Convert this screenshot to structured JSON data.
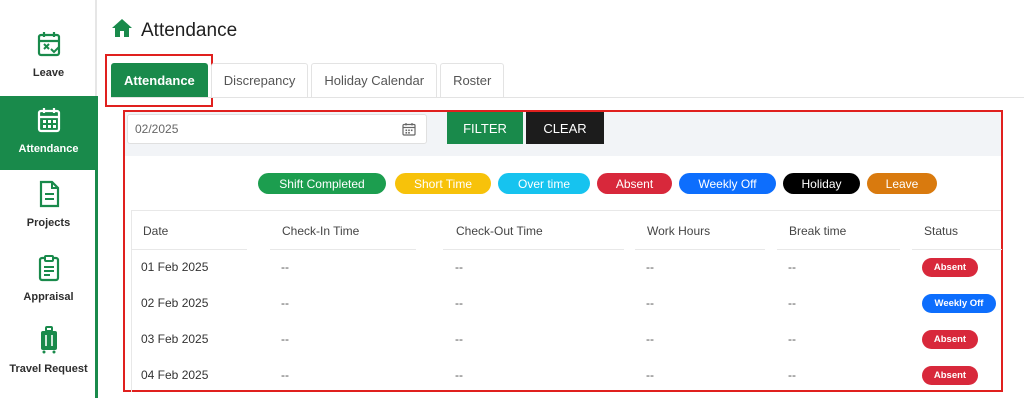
{
  "sidebar": {
    "items": [
      {
        "label": "Leave",
        "icon": "calendar-x-icon"
      },
      {
        "label": "Attendance",
        "icon": "calendar-grid-icon",
        "active": true
      },
      {
        "label": "Projects",
        "icon": "document-icon"
      },
      {
        "label": "Appraisal",
        "icon": "clipboard-icon"
      },
      {
        "label": "Travel Request",
        "icon": "luggage-icon"
      }
    ]
  },
  "header": {
    "title": "Attendance",
    "icon": "home-icon"
  },
  "tabs": [
    {
      "label": "Attendance",
      "active": true
    },
    {
      "label": "Discrepancy"
    },
    {
      "label": "Holiday Calendar"
    },
    {
      "label": "Roster"
    }
  ],
  "filter": {
    "date_value": "02/2025",
    "filter_label": "FILTER",
    "clear_label": "CLEAR"
  },
  "legend": [
    {
      "label": "Shift Completed",
      "color": "#1c9e4f"
    },
    {
      "label": "Short Time",
      "color": "#f7c20a"
    },
    {
      "label": "Over time",
      "color": "#16c3ef"
    },
    {
      "label": "Absent",
      "color": "#d8283b"
    },
    {
      "label": "Weekly Off",
      "color": "#0d6efd"
    },
    {
      "label": "Holiday",
      "color": "#000000"
    },
    {
      "label": "Leave",
      "color": "#d97a0e"
    }
  ],
  "table": {
    "headers": [
      "Date",
      "Check-In Time",
      "Check-Out Time",
      "Work Hours",
      "Break time",
      "Status"
    ],
    "rows": [
      {
        "date": "01 Feb 2025",
        "check_in": "--",
        "check_out": "--",
        "work_hours": "--",
        "break_time": "--",
        "status": "Absent"
      },
      {
        "date": "02 Feb 2025",
        "check_in": "--",
        "check_out": "--",
        "work_hours": "--",
        "break_time": "--",
        "status": "Weekly Off"
      },
      {
        "date": "03 Feb 2025",
        "check_in": "--",
        "check_out": "--",
        "work_hours": "--",
        "break_time": "--",
        "status": "Absent"
      },
      {
        "date": "04 Feb 2025",
        "check_in": "--",
        "check_out": "--",
        "work_hours": "--",
        "break_time": "--",
        "status": "Absent"
      }
    ]
  },
  "colors": {
    "primary": "#198a4b",
    "highlight_border": "#e0201e"
  }
}
